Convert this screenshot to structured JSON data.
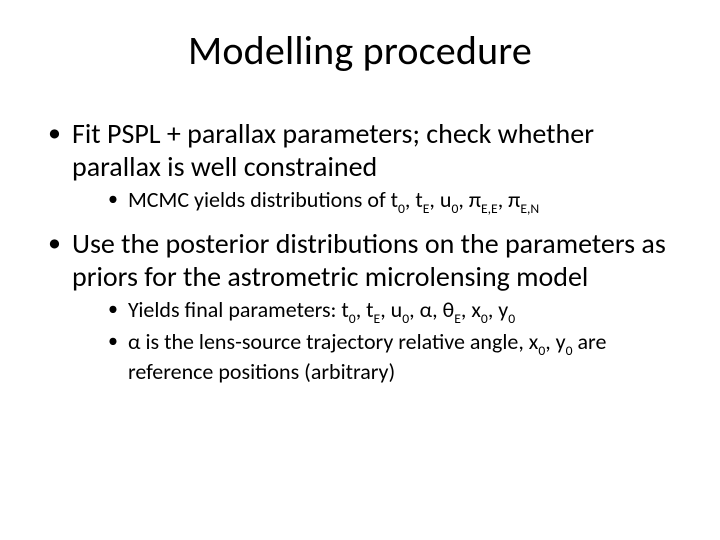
{
  "title": "Modelling procedure",
  "bullets": {
    "b1": "Fit PSPL + parallax parameters; check whether parallax is well constrained",
    "b1_1_prefix": "MCMC yields distributions of t",
    "b2": "Use the posterior distributions on the parameters as priors for the astrometric microlensing model",
    "b2_1_prefix": "Yields final parameters: t",
    "b2_2_prefix": "α is the lens-source trajectory relative angle, x",
    "b2_2_suffix": " are reference positions (arbitrary)"
  },
  "sym": {
    "t0_sub": "0",
    "tE_base": ", t",
    "tE_sub": "E",
    "u0_base": ", u",
    "u0_sub": "0",
    "piEE_base": ", π",
    "piEE_sub": "E,E",
    "piEN_base": ", π",
    "piEN_sub": "E,N",
    "alpha": ", α, θ",
    "thetaE_sub": "E",
    "x0_base": ", x",
    "x0_sub": "0",
    "y0_base": ", y",
    "y0_sub": "0"
  }
}
